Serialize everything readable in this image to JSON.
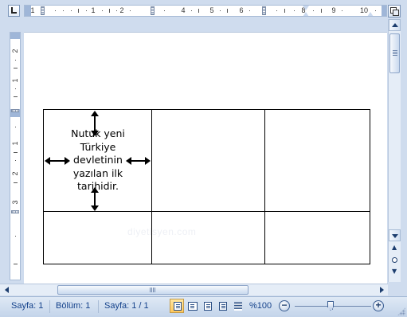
{
  "hruler": {
    "labels": [
      "1",
      "1",
      "2",
      "4",
      "5",
      "6",
      "8",
      "9",
      "10"
    ]
  },
  "vruler": {
    "labels": [
      "2",
      "1",
      "1",
      "2",
      "3"
    ]
  },
  "document": {
    "cell_text": "Nutuk yeni Türkiye devletinin yazılan ilk tarihidir.",
    "watermark": "diyetisyen.com",
    "arrow_color": "#000000"
  },
  "statusbar": {
    "page_label": "Sayfa: 1",
    "section_label": "Bölüm: 1",
    "page_count_label": "Sayfa: 1 / 1",
    "zoom_level": "%100",
    "zoom_out_glyph": "−",
    "zoom_in_glyph": "+",
    "views": [
      {
        "name": "print-layout-icon",
        "active": true
      },
      {
        "name": "full-screen-reading-icon",
        "active": false
      },
      {
        "name": "web-layout-icon",
        "active": false
      },
      {
        "name": "outline-icon",
        "active": false
      },
      {
        "name": "draft-icon",
        "active": false
      }
    ]
  },
  "colors": {
    "chrome_bg": "#cfdcee",
    "status_text": "#15428b",
    "active_view": "#ffc75a"
  }
}
